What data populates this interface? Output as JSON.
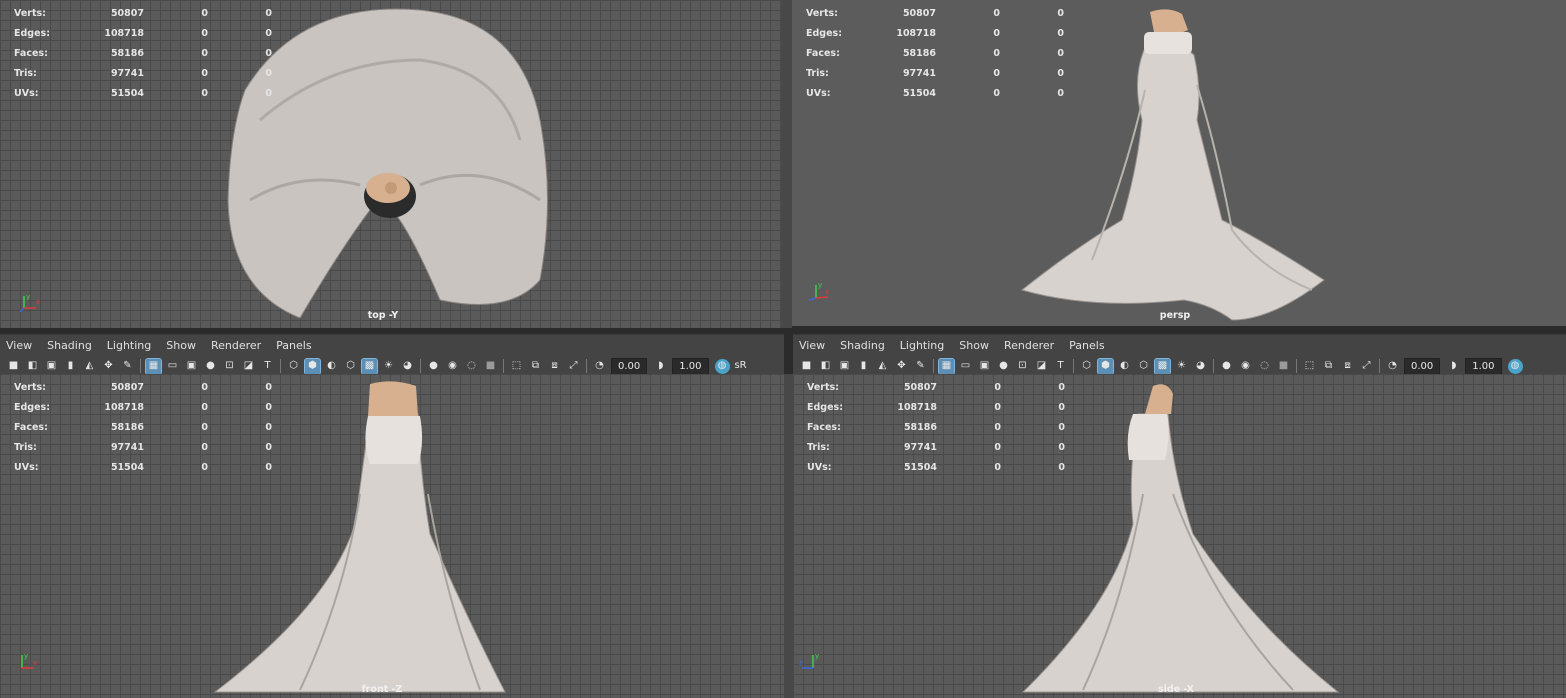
{
  "stats_rows": [
    {
      "label": "Verts:",
      "value": "50807",
      "sel": "0",
      "comp": "0"
    },
    {
      "label": "Edges:",
      "value": "108718",
      "sel": "0",
      "comp": "0"
    },
    {
      "label": "Faces:",
      "value": "58186",
      "sel": "0",
      "comp": "0"
    },
    {
      "label": "Tris:",
      "value": "97741",
      "sel": "0",
      "comp": "0"
    },
    {
      "label": "UVs:",
      "value": "51504",
      "sel": "0",
      "comp": "0"
    }
  ],
  "viewports": {
    "top": {
      "camera": "top -Y"
    },
    "persp": {
      "camera": "persp"
    },
    "front": {
      "camera": "front -Z"
    },
    "side": {
      "camera": "side -X"
    }
  },
  "panel_menu": [
    "View",
    "Shading",
    "Lighting",
    "Show",
    "Renderer",
    "Panels"
  ],
  "toolbar": {
    "exposure_value": "0.00",
    "gamma_value": "1.00",
    "color_space_label": "sR"
  },
  "axis_labels": {
    "x": "x",
    "y": "y",
    "z": "z"
  },
  "colors": {
    "viewport_grid": "#5a5a5a",
    "grid_line": "#4a4a4a",
    "panel_bar": "#444444",
    "active_toggle": "#5b8fb5",
    "dress": "#e2dcd8",
    "skin": "#d6b08f"
  }
}
